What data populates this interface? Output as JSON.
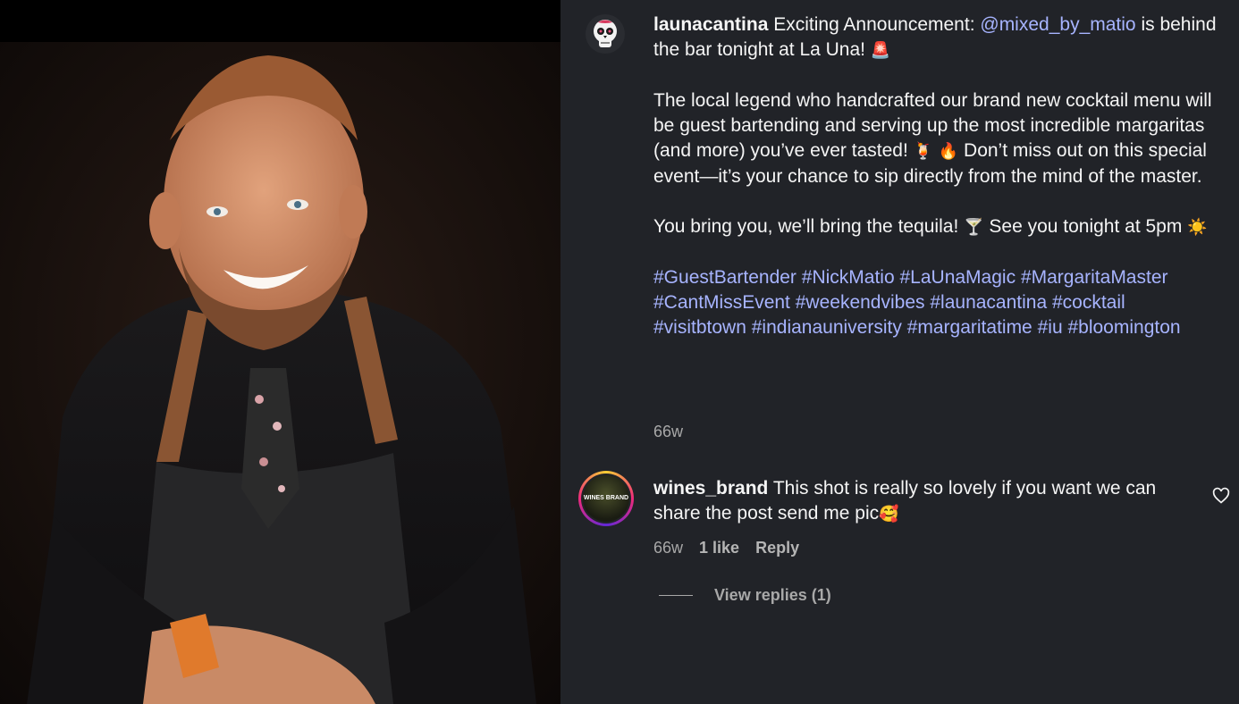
{
  "post": {
    "username": "launacantina",
    "caption_intro": "Exciting Announcement: ",
    "mention": "@mixed_by_matio",
    "caption_intro_end": " is behind the bar tonight at La Una! ",
    "emoji_siren": "🚨",
    "paragraph2_a": "The local legend who handcrafted our brand new cocktail menu will be guest bartending and serving up the most incredible margaritas (and more) you’ve ever tasted! ",
    "emoji_drink_fire": "🍹 🔥",
    "paragraph2_b": " Don’t miss out on this special event—it’s your chance to sip directly from the mind of the master.",
    "paragraph3_a": "You bring you, we’ll bring the tequila! ",
    "emoji_cocktail": "🍸",
    "paragraph3_b": " See you tonight at 5pm ",
    "emoji_sun": "☀️",
    "hashtags": [
      "#GuestBartender",
      "#NickMatio",
      "#LaUnaMagic",
      "#MargaritaMaster",
      "#CantMissEvent",
      "#weekendvibes",
      "#launacantina",
      "#cocktail",
      "#visitbtown",
      "#indianauniversity",
      "#margaritatime",
      "#iu",
      "#bloomington"
    ],
    "time": "66w"
  },
  "comment": {
    "username": "wines_brand",
    "text": "This shot is really so lovely if you want we can share the post send me pic",
    "emoji": "🥰",
    "time": "66w",
    "likes": "1 like",
    "reply_label": "Reply",
    "view_replies": "View replies (1)",
    "avatar_text": "WINES BRAND"
  },
  "colors": {
    "panel_bg": "#212328",
    "link": "#a7b4ff",
    "muted": "#a8a8a8"
  }
}
